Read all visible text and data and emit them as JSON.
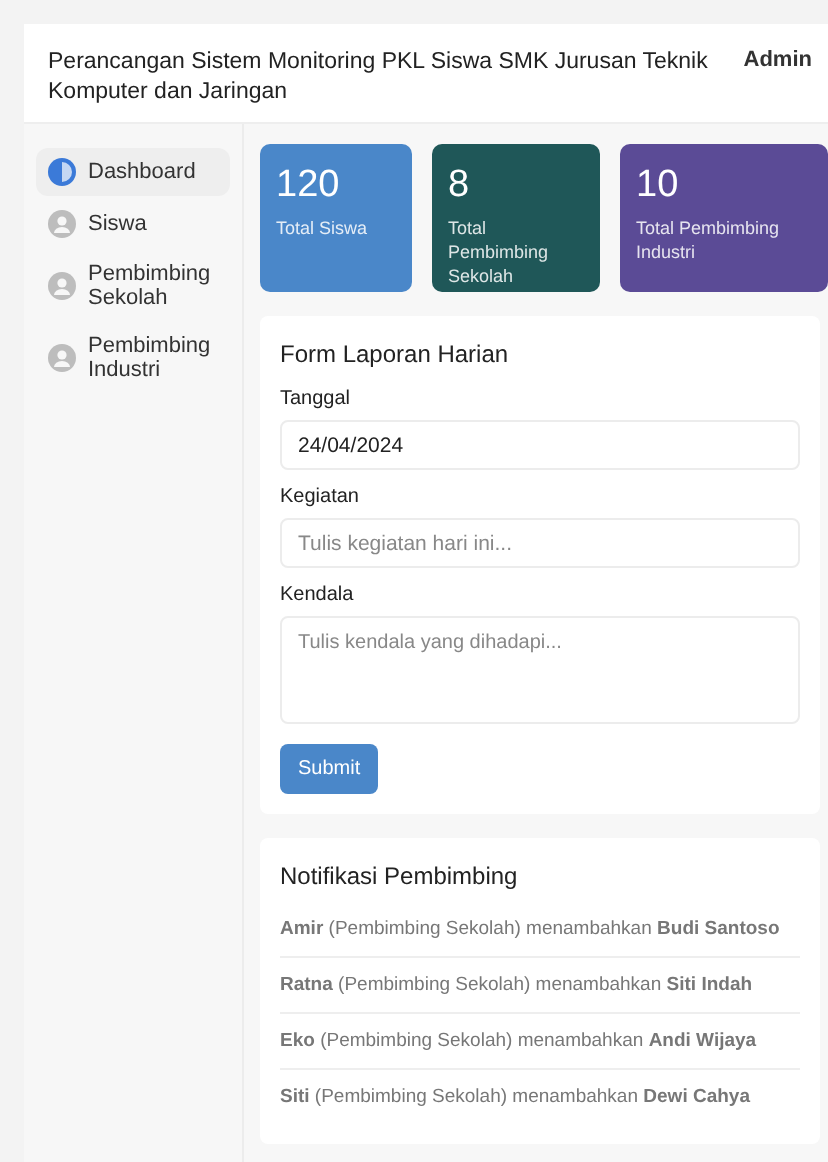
{
  "header": {
    "title": "Perancangan Sistem Monitoring PKL Siswa SMK Jurusan Teknik Komputer dan Jaringan",
    "user": "Admin"
  },
  "sidebar": {
    "items": [
      {
        "label": "Dashboard",
        "selected": true
      },
      {
        "label": "Siswa",
        "selected": false
      },
      {
        "label": "Pembimbing Sekolah",
        "selected": false
      },
      {
        "label": "Pembimbing Industri",
        "selected": false
      }
    ]
  },
  "stats": [
    {
      "value": "120",
      "label": "Total Siswa",
      "color": "#4a87c9"
    },
    {
      "value": "8",
      "label": "Total Pembimbing Sekolah",
      "color": "#1f5758"
    },
    {
      "value": "10",
      "label": "Total Pembimbing Industri",
      "color": "#5b4b96"
    }
  ],
  "form": {
    "title": "Form Laporan Harian",
    "fields": [
      {
        "kind": "input",
        "label": "Tanggal",
        "value": "24/04/2024"
      },
      {
        "kind": "input",
        "label": "Kegiatan",
        "placeholder": "Tulis kegiatan hari ini..."
      },
      {
        "kind": "textarea",
        "label": "Kendala",
        "placeholder": "Tulis kendala yang dihadapi..."
      }
    ],
    "submit": "Submit"
  },
  "notifications": {
    "title": "Notifikasi Pembimbing",
    "items": [
      "**Amir** (Pembimbing Sekolah) menambahkan **Budi Santoso**",
      "**Ratna** (Pembimbing Sekolah) menambahkan **Siti Indah**",
      "**Eko** (Pembimbing Sekolah) menambahkan **Andi Wijaya**",
      "**Siti** (Pembimbing Sekolah) menambahkan **Dewi Cahya**"
    ]
  }
}
